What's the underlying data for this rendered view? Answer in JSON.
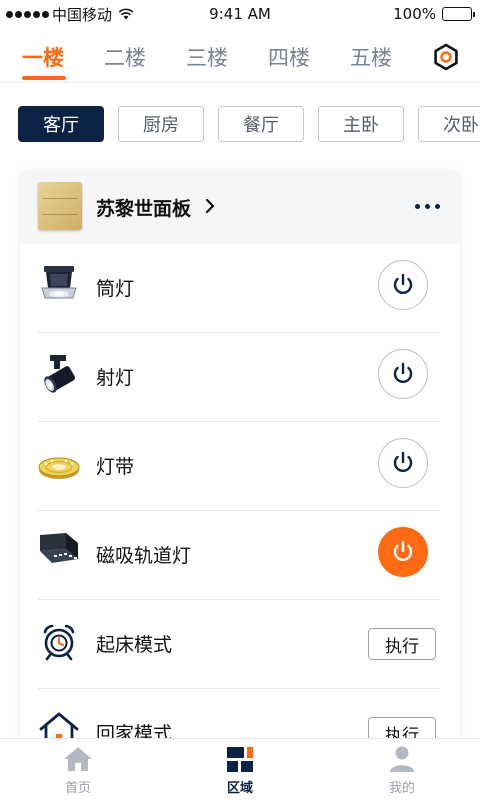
{
  "status_bar": {
    "carrier": "中国移动",
    "time": "9:41 AM",
    "battery": "100%"
  },
  "floor_tabs": [
    {
      "label": "一楼",
      "active": true
    },
    {
      "label": "二楼",
      "active": false
    },
    {
      "label": "三楼",
      "active": false
    },
    {
      "label": "四楼",
      "active": false
    },
    {
      "label": "五楼",
      "active": false
    }
  ],
  "room_chips": [
    {
      "label": "客厅",
      "active": true
    },
    {
      "label": "厨房",
      "active": false
    },
    {
      "label": "餐厅",
      "active": false
    },
    {
      "label": "主卧",
      "active": false
    },
    {
      "label": "次卧",
      "active": false
    }
  ],
  "panel": {
    "title": "苏黎世面板"
  },
  "devices": [
    {
      "name": "筒灯",
      "icon": "downlight-icon",
      "state": "off"
    },
    {
      "name": "射灯",
      "icon": "spotlight-icon",
      "state": "off"
    },
    {
      "name": "灯带",
      "icon": "light-strip-icon",
      "state": "off"
    },
    {
      "name": "磁吸轨道灯",
      "icon": "track-light-icon",
      "state": "on"
    }
  ],
  "scenes": [
    {
      "name": "起床模式",
      "icon": "alarm-clock-icon",
      "action_label": "执行"
    },
    {
      "name": "回家模式",
      "icon": "home-icon",
      "action_label": "执行"
    }
  ],
  "bottom_nav": [
    {
      "label": "首页",
      "icon": "home-nav-icon",
      "active": false
    },
    {
      "label": "区域",
      "icon": "area-grid-icon",
      "active": true
    },
    {
      "label": "我的",
      "icon": "profile-icon",
      "active": false
    }
  ],
  "colors": {
    "accent": "#ff6a13",
    "primary_dark": "#0d2345",
    "inactive_text": "#7a8492"
  }
}
